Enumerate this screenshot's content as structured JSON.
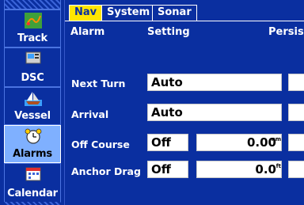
{
  "sidebar": {
    "items": [
      {
        "label": "Track",
        "icon": "track-icon"
      },
      {
        "label": "DSC",
        "icon": "dsc-icon"
      },
      {
        "label": "Vessel",
        "icon": "vessel-icon"
      },
      {
        "label": "Alarms",
        "icon": "alarm-clock-icon",
        "active": true
      },
      {
        "label": "Calendar",
        "icon": "calendar-icon"
      }
    ]
  },
  "tabs": [
    {
      "label": "Nav",
      "active": true
    },
    {
      "label": "System"
    },
    {
      "label": "Sonar"
    }
  ],
  "header": {
    "alarm": "Alarm",
    "setting": "Setting",
    "persist": "Persis"
  },
  "rows": [
    {
      "label": "Next Turn",
      "value": "Auto"
    },
    {
      "label": "Arrival",
      "value": "Auto"
    },
    {
      "label": "Off Course",
      "value": "Off",
      "number": "0.00",
      "unit": "nm"
    },
    {
      "label": "Anchor Drag",
      "value": "Off",
      "number": "0.0",
      "unit": "ft"
    }
  ],
  "colors": {
    "background": "#0a2fa0",
    "active_tab": "#ffe600",
    "active_sidebar": "#7fb0ff"
  }
}
